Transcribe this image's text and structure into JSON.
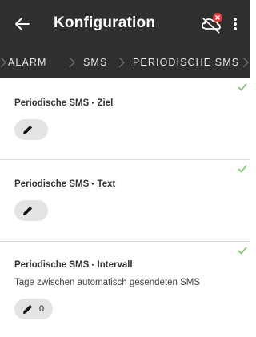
{
  "appbar": {
    "title": "Konfiguration",
    "back_icon": "arrow-back-icon",
    "status_icon": "cloud-off-icon",
    "menu_icon": "more-vert-icon"
  },
  "breadcrumbs": [
    "ALARM",
    "SMS",
    "PERIODISCHE SMS"
  ],
  "settings": [
    {
      "label": "Periodische SMS - Ziel",
      "description": "",
      "value": ""
    },
    {
      "label": "Periodische SMS - Text",
      "description": "",
      "value": ""
    },
    {
      "label": "Periodische SMS - Intervall",
      "description": "Tage zwischen automatisch gesendeten SMS",
      "value": "0"
    }
  ],
  "colors": {
    "appbar": "#2f2f2f",
    "check": "#7cc66a",
    "badge": "#e23a3a",
    "chip": "#e4e4e4"
  }
}
